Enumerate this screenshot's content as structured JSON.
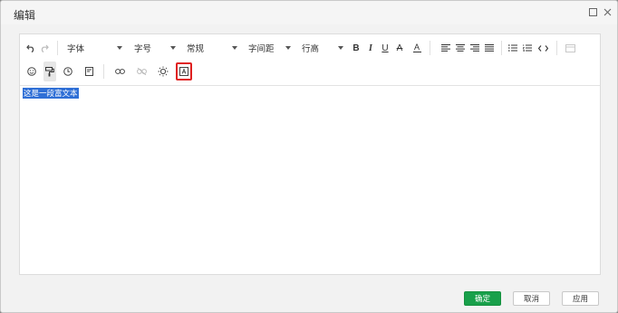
{
  "dialog": {
    "title": "编辑",
    "window_buttons": {
      "maximize_icon": "square-icon",
      "close_icon": "x-icon"
    }
  },
  "toolbar": {
    "font_family": "字体",
    "font_size": "字号",
    "paragraph_style": "常规",
    "letter_spacing": "字间距",
    "line_height": "行高",
    "bold": "B",
    "italic": "I",
    "underline": "U",
    "strikethrough": "A",
    "font_color": "A",
    "row2_icons": [
      "emoji-icon",
      "format-painter-icon",
      "clock-icon",
      "template-icon",
      "link-icon",
      "unlink-icon",
      "bulb-icon",
      "textbox-icon"
    ]
  },
  "content": {
    "text": "这是一段富文本"
  },
  "footer": {
    "ok_label": "确定",
    "cancel_label": "取消",
    "apply_label": "应用"
  },
  "colors": {
    "primary_button": "#19a04b",
    "selection": "#2f6fd6",
    "highlight_border": "#e02020"
  }
}
